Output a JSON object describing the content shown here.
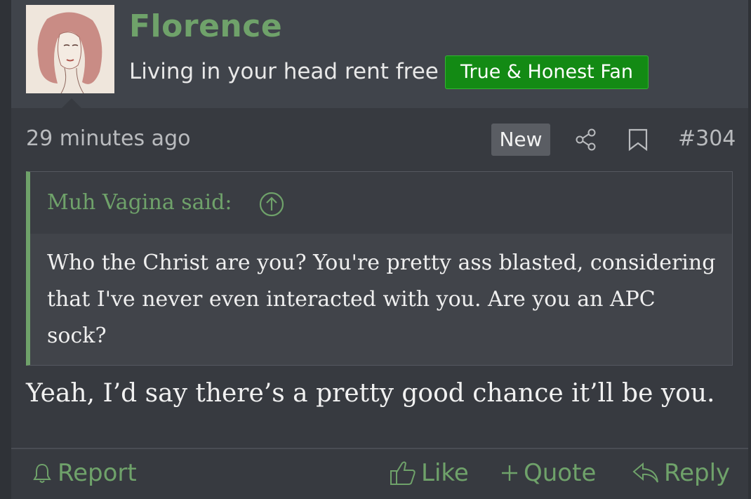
{
  "author": {
    "name": "Florence",
    "title": "Living in your head rent free",
    "banner": "True & Honest Fan",
    "avatar_icon": "portrait-avatar"
  },
  "meta": {
    "time": "29 minutes ago",
    "new_badge": "New",
    "share_icon": "share-icon",
    "bookmark_icon": "bookmark-icon",
    "post_number": "#304"
  },
  "quote": {
    "attribution": "Muh Vagina said:",
    "expand_icon": "arrow-up-circle-icon",
    "text": "Who the Christ are you? You're pretty ass blasted, considering that I've never even interacted with you. Are you an APC sock?"
  },
  "body": {
    "text": "Yeah, I’d say there’s a pretty good chance it’ll be you."
  },
  "actions": {
    "report": "Report",
    "like": "Like",
    "quote": "Quote",
    "reply": "Reply"
  },
  "colors": {
    "accent": "#6fa26a",
    "banner": "#138a14",
    "background": "#373a40"
  }
}
